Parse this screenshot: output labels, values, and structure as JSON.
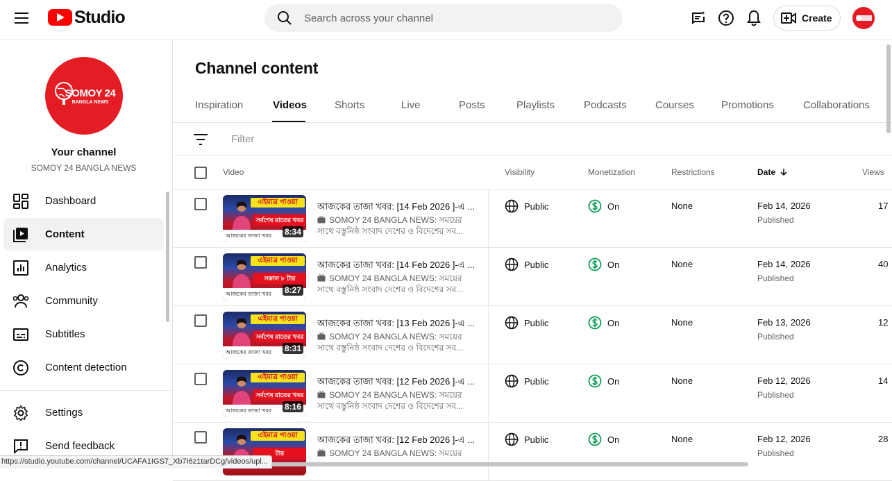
{
  "header": {
    "logo_text": "Studio",
    "search_placeholder": "Search across your channel",
    "create_label": "Create"
  },
  "sidebar": {
    "channel_logo_line1": "SOMOY 24",
    "channel_logo_line2": "BANGLA NEWS",
    "your_channel": "Your channel",
    "channel_name": "SOMOY 24 BANGLA NEWS",
    "items": [
      {
        "label": "Dashboard",
        "icon": "dashboard-icon"
      },
      {
        "label": "Content",
        "icon": "content-icon",
        "active": true
      },
      {
        "label": "Analytics",
        "icon": "analytics-icon"
      },
      {
        "label": "Community",
        "icon": "community-icon"
      },
      {
        "label": "Subtitles",
        "icon": "subtitles-icon"
      },
      {
        "label": "Content detection",
        "icon": "copyright-icon"
      }
    ],
    "bottom_items": [
      {
        "label": "Settings",
        "icon": "gear-icon"
      },
      {
        "label": "Send feedback",
        "icon": "feedback-icon"
      }
    ]
  },
  "main": {
    "title": "Channel content",
    "tabs": [
      "Inspiration",
      "Videos",
      "Shorts",
      "Live",
      "Posts",
      "Playlists",
      "Podcasts",
      "Courses",
      "Promotions",
      "Collaborations"
    ],
    "active_tab": "Videos",
    "filter_placeholder": "Filter",
    "columns": {
      "video": "Video",
      "visibility": "Visibility",
      "monetization": "Monetization",
      "restrictions": "Restrictions",
      "date": "Date",
      "views": "Views"
    },
    "rows": [
      {
        "title": "আজকের তাজা খবর: [14 Feb 2026 ]-এ ...",
        "desc1": "SOMOY 24 BANGLA NEWS: সময়ের",
        "desc2": "সাথে বস্তুনিষ্ঠ সংবাদ দেশের ও বিদেশের সব...",
        "duration": "8:34",
        "thumb_banner": "এইমাত্র পাওয়া",
        "thumb_band": "সর্বশেষ রাতের খবর",
        "thumb_footer": "আজকের তাজা খবর",
        "visibility": "Public",
        "monetization": "On",
        "restrictions": "None",
        "date": "Feb 14, 2026",
        "status": "Published",
        "views": "17"
      },
      {
        "title": "আজকের তাজা খবর: [14 Feb 2026 ]-এ ...",
        "desc1": "SOMOY 24 BANGLA NEWS: সময়ের",
        "desc2": "সাথে বস্তুনিষ্ঠ সংবাদ দেশের ও বিদেশের সব...",
        "duration": "8:27",
        "thumb_banner": "এইমাত্র পাওয়া",
        "thumb_band": "সকাল ৮ টার",
        "thumb_footer": "আজকের তাজা খবর",
        "visibility": "Public",
        "monetization": "On",
        "restrictions": "None",
        "date": "Feb 14, 2026",
        "status": "Published",
        "views": "40"
      },
      {
        "title": "আজকের তাজা খবর: [13 Feb 2026 ]-এ ...",
        "desc1": "SOMOY 24 BANGLA NEWS: সময়ের",
        "desc2": "সাথে বস্তুনিষ্ঠ সংবাদ দেশের ও বিদেশের সব...",
        "duration": "8:31",
        "thumb_banner": "এইমাত্র পাওয়া",
        "thumb_band": "সর্বশেষ রাতের খবর",
        "thumb_footer": "আজকের তাজা খবর",
        "visibility": "Public",
        "monetization": "On",
        "restrictions": "None",
        "date": "Feb 13, 2026",
        "status": "Published",
        "views": "12"
      },
      {
        "title": "আজকের তাজা খবর: [12 Feb 2026 ]-এ ...",
        "desc1": "SOMOY 24 BANGLA NEWS: সময়ের",
        "desc2": "সাথে বস্তুনিষ্ঠ সংবাদ দেশের ও বিদেশের সব...",
        "duration": "8:16",
        "thumb_banner": "এইমাত্র পাওয়া",
        "thumb_band": "সর্বশেষ রাতের খবর",
        "thumb_footer": "আজকের তাজা খবর",
        "visibility": "Public",
        "monetization": "On",
        "restrictions": "None",
        "date": "Feb 12, 2026",
        "status": "Published",
        "views": "14"
      },
      {
        "title": "আজকের তাজা খবর: [12 Feb 2026 ]-এ ...",
        "desc1": "SOMOY 24 BANGLA NEWS: সময়ের",
        "desc2": "",
        "duration": "",
        "thumb_banner": "এইমাত্র পাওয়া",
        "thumb_band": "টার",
        "thumb_footer": "",
        "visibility": "Public",
        "monetization": "On",
        "restrictions": "None",
        "date": "Feb 12, 2026",
        "status": "Published",
        "views": "28"
      }
    ]
  },
  "status_bar": "https://studio.youtube.com/channel/UCAFA1IGS7_Xb7I6z1tarDCg/videos/upl..."
}
